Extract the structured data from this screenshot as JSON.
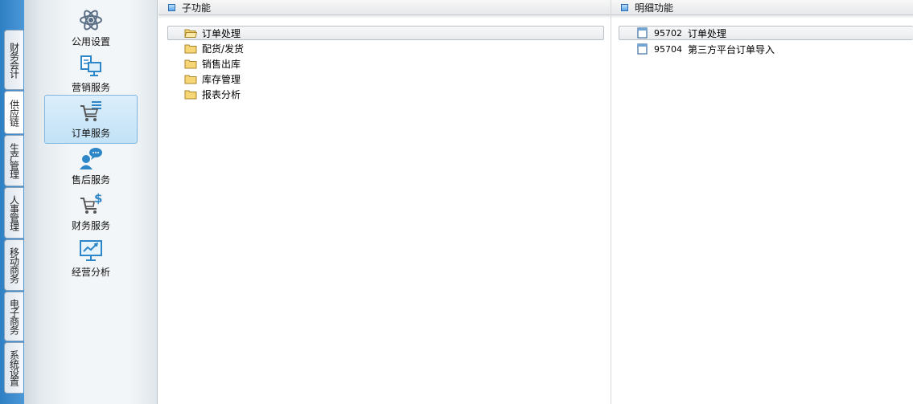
{
  "vertical_tabs": [
    {
      "label": "财务会计"
    },
    {
      "label": "供应链"
    },
    {
      "label": "生产管理"
    },
    {
      "label": "人事管理"
    },
    {
      "label": "移动商务"
    },
    {
      "label": "电子商务"
    },
    {
      "label": "系统设置"
    }
  ],
  "modules": [
    {
      "label": "公用设置",
      "icon": "atom-icon"
    },
    {
      "label": "营销服务",
      "icon": "marketing-icon"
    },
    {
      "label": "订单服务",
      "icon": "cart-list-icon",
      "selected": true
    },
    {
      "label": "售后服务",
      "icon": "support-chat-icon"
    },
    {
      "label": "财务服务",
      "icon": "cart-dollar-icon"
    },
    {
      "label": "经营分析",
      "icon": "chart-monitor-icon"
    }
  ],
  "sub_panel": {
    "title": "子功能",
    "items": [
      {
        "label": "订单处理",
        "selected": true
      },
      {
        "label": "配货/发货"
      },
      {
        "label": "销售出库"
      },
      {
        "label": "库存管理"
      },
      {
        "label": "报表分析"
      }
    ]
  },
  "detail_panel": {
    "title": "明细功能",
    "items": [
      {
        "code": "95702",
        "label": "订单处理",
        "selected": true
      },
      {
        "code": "95704",
        "label": "第三方平台订单导入"
      }
    ]
  },
  "colors": {
    "rail": "#3a8ace",
    "module_selected_bg": "#cfe8f9",
    "icon_blue": "#2d86c7"
  }
}
